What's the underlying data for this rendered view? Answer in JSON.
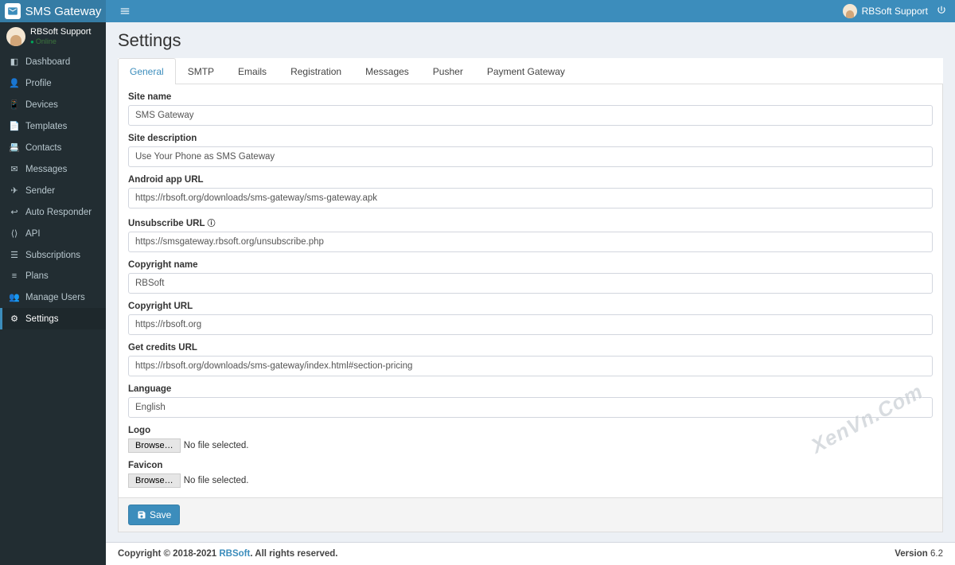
{
  "brand": {
    "name": "SMS Gateway"
  },
  "header": {
    "user_name": "RBSoft Support"
  },
  "sidebar": {
    "user": {
      "name": "RBSoft Support",
      "status": "Online"
    },
    "items": [
      {
        "label": "Dashboard"
      },
      {
        "label": "Profile"
      },
      {
        "label": "Devices"
      },
      {
        "label": "Templates"
      },
      {
        "label": "Contacts"
      },
      {
        "label": "Messages"
      },
      {
        "label": "Sender"
      },
      {
        "label": "Auto Responder"
      },
      {
        "label": "API"
      },
      {
        "label": "Subscriptions"
      },
      {
        "label": "Plans"
      },
      {
        "label": "Manage Users"
      },
      {
        "label": "Settings"
      }
    ]
  },
  "page": {
    "title": "Settings"
  },
  "tabs": [
    {
      "label": "General"
    },
    {
      "label": "SMTP"
    },
    {
      "label": "Emails"
    },
    {
      "label": "Registration"
    },
    {
      "label": "Messages"
    },
    {
      "label": "Pusher"
    },
    {
      "label": "Payment Gateway"
    }
  ],
  "form": {
    "site_name": {
      "label": "Site name",
      "value": "SMS Gateway"
    },
    "site_description": {
      "label": "Site description",
      "value": "Use Your Phone as SMS Gateway"
    },
    "android_app_url": {
      "label": "Android app URL",
      "value": "https://rbsoft.org/downloads/sms-gateway/sms-gateway.apk"
    },
    "unsubscribe_url": {
      "label": "Unsubscribe URL",
      "value": "https://smsgateway.rbsoft.org/unsubscribe.php"
    },
    "copyright_name": {
      "label": "Copyright name",
      "value": "RBSoft"
    },
    "copyright_url": {
      "label": "Copyright URL",
      "value": "https://rbsoft.org"
    },
    "get_credits_url": {
      "label": "Get credits URL",
      "value": "https://rbsoft.org/downloads/sms-gateway/index.html#section-pricing"
    },
    "language": {
      "label": "Language",
      "value": "English"
    },
    "logo": {
      "label": "Logo",
      "browse": "Browse…",
      "status": "No file selected."
    },
    "favicon": {
      "label": "Favicon",
      "browse": "Browse…",
      "status": "No file selected."
    }
  },
  "actions": {
    "save": "Save"
  },
  "footer": {
    "copyright_prefix": "Copyright © 2018-2021 ",
    "copyright_link": "RBSoft",
    "copyright_suffix": ". All rights reserved.",
    "version_label": "Version",
    "version": "6.2"
  },
  "watermark": "XenVn.Com"
}
